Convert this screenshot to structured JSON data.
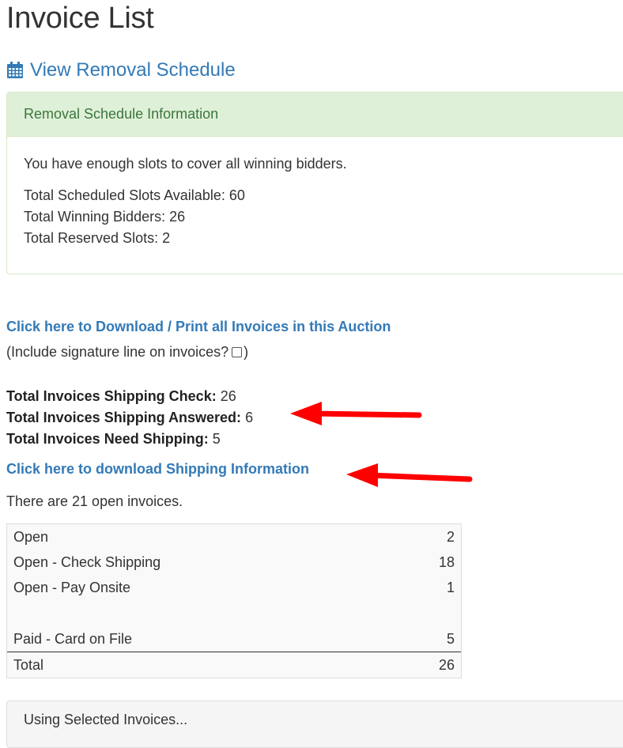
{
  "page": {
    "title": "Invoice List",
    "schedule_link": "View Removal Schedule",
    "schedule_icon": "calendar-icon"
  },
  "removal_panel": {
    "heading": "Removal Schedule Information",
    "message": "You have enough slots to cover all winning bidders.",
    "lines": [
      "Total Scheduled Slots Available: 60",
      "Total Winning Bidders: 26",
      "Total Reserved Slots: 2"
    ]
  },
  "download": {
    "link": "Click here to Download / Print all Invoices in this Auction",
    "signature_prefix": "(Include signature line on invoices?",
    "signature_suffix": ")",
    "signature_checked": false
  },
  "stats": [
    {
      "label": "Total Invoices Shipping Check:",
      "value": "26"
    },
    {
      "label": "Total Invoices Shipping Answered:",
      "value": "6"
    },
    {
      "label": "Total Invoices Need Shipping:",
      "value": "5"
    }
  ],
  "shipping_link": "Click here to download Shipping Information",
  "open_text": "There are 21 open invoices.",
  "status_table": {
    "rows": [
      {
        "label": "Open",
        "value": "2"
      },
      {
        "label": "Open - Check Shipping",
        "value": "18"
      },
      {
        "label": "Open - Pay Onsite",
        "value": "1"
      },
      {
        "label": "",
        "value": ""
      },
      {
        "label": "Paid - Card on File",
        "value": "5"
      }
    ],
    "total": {
      "label": "Total",
      "value": "26"
    }
  },
  "selected_panel": "Using Selected Invoices...",
  "colors": {
    "link": "#337ab7",
    "panel_success_bg": "#dff0d8",
    "panel_success_text": "#3c763d",
    "annotation_arrow": "#ff0000"
  }
}
